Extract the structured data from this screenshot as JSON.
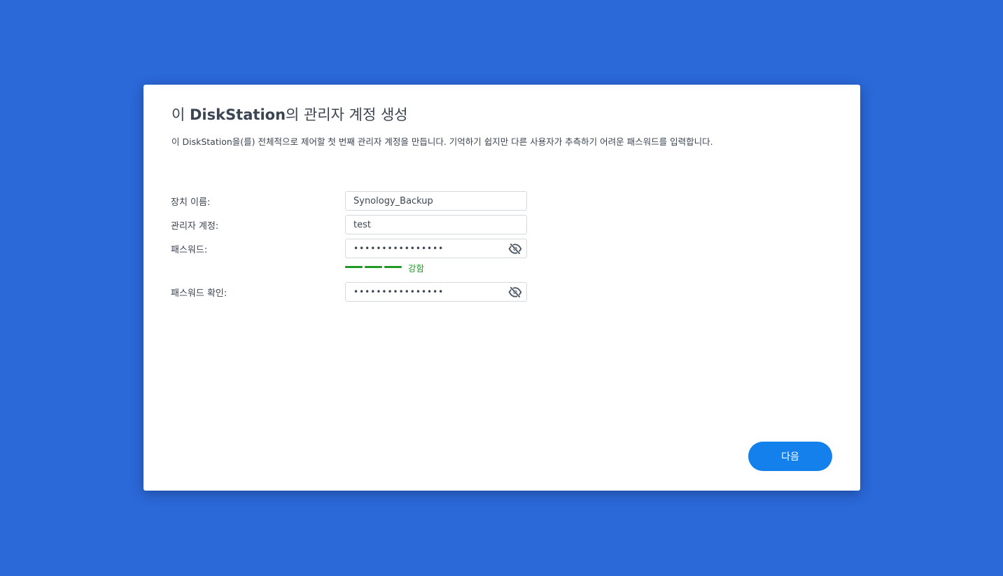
{
  "dialog": {
    "title_prefix": "이 ",
    "title_brand": "DiskStation",
    "title_suffix": "의 관리자 계정 생성",
    "description": "이 DiskStation을(를) 전체적으로 제어할 첫 번째 관리자 계정을 만듭니다. 기억하기 쉽지만 다른 사용자가 추측하기 어려운 패스워드를 입력합니다."
  },
  "form": {
    "device_name": {
      "label": "장치 이름:",
      "value": "Synology_Backup"
    },
    "admin_account": {
      "label": "관리자 계정:",
      "value": "test"
    },
    "password": {
      "label": "패스워드:",
      "value": "••••••••••••••••",
      "icon": "eye-off-icon"
    },
    "strength": {
      "label": "강함",
      "level": 1.0,
      "color": "#1e9a25"
    },
    "confirm_password": {
      "label": "패스워드 확인:",
      "value": "••••••••••••••••",
      "icon": "eye-off-icon"
    }
  },
  "actions": {
    "next_label": "다음"
  },
  "colors": {
    "background": "#2b68d8",
    "accent": "#1380eb",
    "strength_strong": "#1e9a25"
  }
}
